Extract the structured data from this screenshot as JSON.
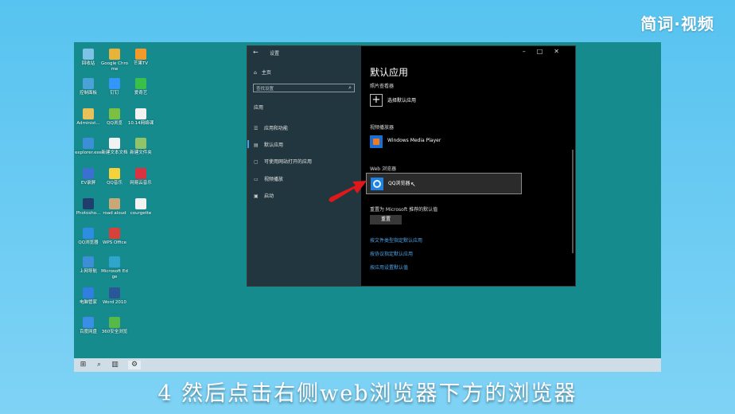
{
  "brand": "简词·视频",
  "caption": "4 然后点击右侧web浏览器下方的浏览器",
  "desktop_icons": [
    {
      "label": "回收站",
      "icon": "recycle-bin-icon",
      "color": "#7ec3e6"
    },
    {
      "label": "Google Chrome",
      "icon": "chrome-icon",
      "color": "#e8b33a"
    },
    {
      "label": "芒果TV",
      "icon": "mango-tv-icon",
      "color": "#f39a2b"
    },
    {
      "label": "控制面板",
      "icon": "control-panel-icon",
      "color": "#4aa3d8"
    },
    {
      "label": "钉钉",
      "icon": "dingtalk-icon",
      "color": "#3296fa"
    },
    {
      "label": "爱奇艺",
      "icon": "iqiyi-icon",
      "color": "#39c04a"
    },
    {
      "label": "Administ...",
      "icon": "user-folder-icon",
      "color": "#e6c15a"
    },
    {
      "label": "QQ浏览",
      "icon": "qq-game-icon",
      "color": "#7bc043"
    },
    {
      "label": "10.14网络课",
      "icon": "document-icon",
      "color": "#f2f2f2"
    },
    {
      "label": "explorer.exe",
      "icon": "ie-icon",
      "color": "#3c8fd6"
    },
    {
      "label": "新建文本文档",
      "icon": "text-file-icon",
      "color": "#f2f2f2"
    },
    {
      "label": "新建文件夹",
      "icon": "folder-icon",
      "color": "#8fc46b"
    },
    {
      "label": "EV录屏",
      "icon": "ev-recorder-icon",
      "color": "#3b6fd1"
    },
    {
      "label": "QQ音乐",
      "icon": "qq-music-icon",
      "color": "#f5d23b"
    },
    {
      "label": "网易云音乐",
      "icon": "netease-music-icon",
      "color": "#d9333f"
    },
    {
      "label": "Photosho...",
      "icon": "photoshop-icon",
      "color": "#1f3e6b"
    },
    {
      "label": "road aloud",
      "icon": "image-file-icon",
      "color": "#c9a778"
    },
    {
      "label": "courgette",
      "icon": "text-file-icon",
      "color": "#f2f2f2"
    },
    {
      "label": "QQ浏览器",
      "icon": "qq-browser-icon",
      "color": "#2e8de0"
    },
    {
      "label": "WPS Office",
      "icon": "wps-icon",
      "color": "#d6423a"
    },
    {
      "label": "上网导航",
      "icon": "ie-nav-icon",
      "color": "#3c8fd6"
    },
    {
      "label": "Microsoft Edge",
      "icon": "edge-icon",
      "color": "#2fa5c9"
    },
    {
      "label": "电脑管家",
      "icon": "pc-manager-icon",
      "color": "#2f7ee0"
    },
    {
      "label": "Word 2010",
      "icon": "word-icon",
      "color": "#2b5797"
    },
    {
      "label": "百度网盘",
      "icon": "baidu-pan-icon",
      "color": "#3a8ee6"
    },
    {
      "label": "360安全浏览",
      "icon": "360-browser-icon",
      "color": "#57b947"
    }
  ],
  "taskbar": {
    "start_icon": "windows-start-icon",
    "search_icon": "search-icon",
    "taskview_icon": "task-view-icon",
    "settings_icon": "gear-icon"
  },
  "settings": {
    "window_title": "设置",
    "home": "主页",
    "search_placeholder": "查找设置",
    "section": "应用",
    "nav": [
      {
        "label": "应用和功能",
        "icon": "list-icon"
      },
      {
        "label": "默认应用",
        "icon": "default-apps-icon"
      },
      {
        "label": "可使用网站打开的应用",
        "icon": "link-app-icon"
      },
      {
        "label": "视频播放",
        "icon": "video-icon"
      },
      {
        "label": "启动",
        "icon": "startup-icon"
      }
    ],
    "page_title": "默认应用",
    "photo_viewer_label": "照片查看器",
    "choose_default": "选择默认应用",
    "video_player_label": "视频播放器",
    "video_player_app": "Windows Media Player",
    "web_browser_label": "Web 浏览器",
    "web_browser_app": "QQ浏览器",
    "reset_label": "重置为 Microsoft 推荐的默认值",
    "reset_button": "重置",
    "links": [
      "按文件类型指定默认应用",
      "按协议指定默认应用",
      "按应用设置默认值"
    ]
  },
  "colors": {
    "desktop": "#158b8d",
    "sidebar": "#21363f",
    "accent_link": "#4ea6e8",
    "annotation_arrow": "#e0181a"
  }
}
